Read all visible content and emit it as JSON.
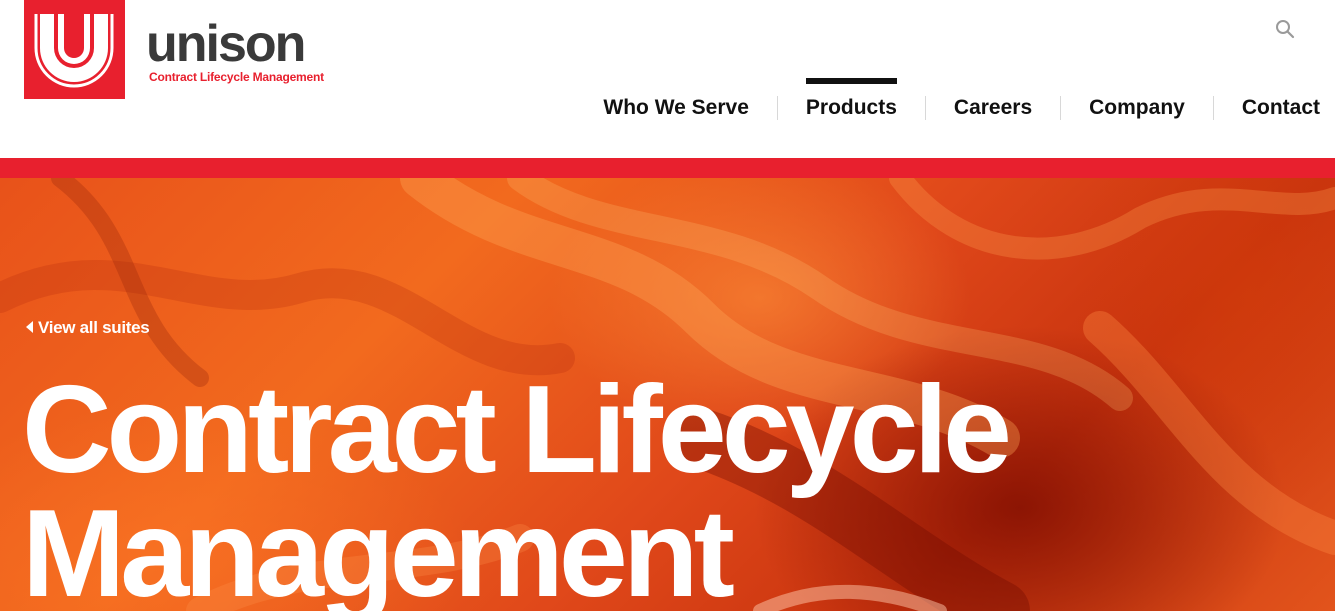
{
  "brand": {
    "name": "unison",
    "tagline": "Contract Lifecycle Management",
    "logo_color": "#e8202e"
  },
  "search": {
    "icon": "search-icon"
  },
  "nav": {
    "items": [
      {
        "label": "Who We Serve",
        "active": false
      },
      {
        "label": "Products",
        "active": true
      },
      {
        "label": "Careers",
        "active": false
      },
      {
        "label": "Company",
        "active": false
      },
      {
        "label": "Contact",
        "active": false
      }
    ]
  },
  "hero": {
    "back_link": "View all suites",
    "back_icon": "chevron-left-icon",
    "title_line1": "Contract Lifecycle",
    "title_line2": "Management"
  },
  "colors": {
    "accent": "#e8202e",
    "nav_text": "#111111",
    "hero_base": "#e8521a"
  }
}
